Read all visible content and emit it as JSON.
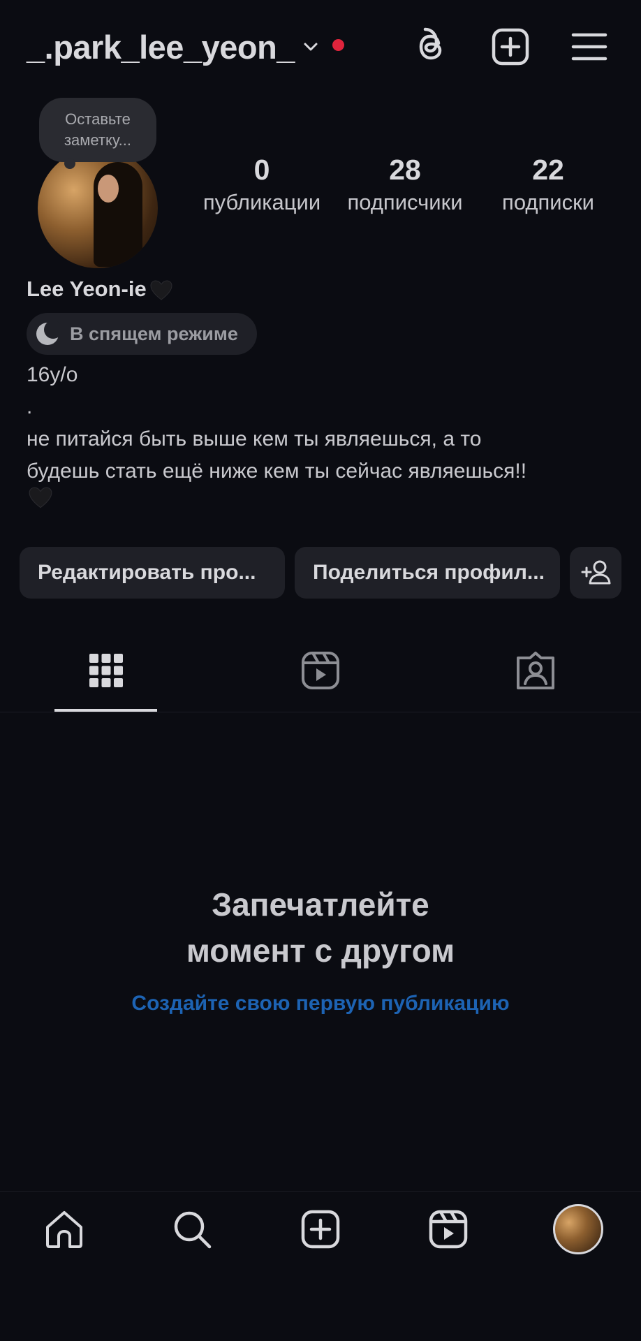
{
  "header": {
    "username": "_.park_lee_yeon_"
  },
  "profile": {
    "note_placeholder": "Оставьте\nзаметку...",
    "stats": [
      {
        "value": "0",
        "label": "публикации"
      },
      {
        "value": "28",
        "label": "подписчики"
      },
      {
        "value": "22",
        "label": "подписки"
      }
    ],
    "display_name": "Lee Yeon-ie",
    "status": "В спящем режиме",
    "bio": "16y/o\n.\nне питайся быть выше кем ты являешься, а то\nбудешь стать ещё ниже кем ты сейчас являешься!!"
  },
  "actions": {
    "edit_profile": "Редактировать про...",
    "share_profile": "Поделиться профил..."
  },
  "empty_state": {
    "title": "Запечатлейте\nмомент с другом",
    "link": "Создайте свою первую публикацию"
  },
  "colors": {
    "background": "#0b0c12",
    "link": "#1d63b3",
    "notification_dot": "#e0243c"
  },
  "icons": {
    "header": [
      "chevron-down-icon",
      "threads-icon",
      "new-post-icon",
      "menu-icon"
    ],
    "tabs": [
      "grid-icon",
      "reels-icon",
      "tagged-icon"
    ],
    "nav": [
      "home-icon",
      "search-icon",
      "create-icon",
      "reels-icon",
      "profile-avatar"
    ]
  }
}
